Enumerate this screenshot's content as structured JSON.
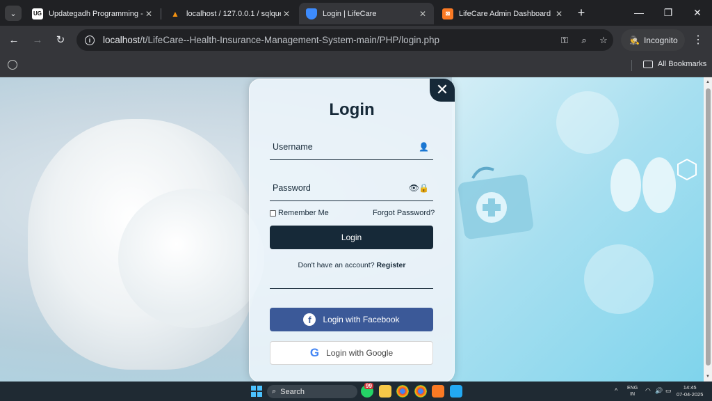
{
  "browser": {
    "tabs": [
      {
        "title": "Updategadh Programming -",
        "active": false,
        "favicon": "ug-logo-icon"
      },
      {
        "title": "localhost / 127.0.0.1 / sqlque",
        "active": false,
        "favicon": "phpmyadmin-icon"
      },
      {
        "title": "Login | LifeCare",
        "active": true,
        "favicon": "shield-icon"
      },
      {
        "title": "LifeCare Admin Dashboard",
        "active": false,
        "favicon": "xampp-icon"
      }
    ],
    "url_host": "localhost",
    "url_path": "/t/LifeCare--Health-Insurance-Management-System-main/PHP/login.php",
    "incognito_label": "Incognito",
    "all_bookmarks_label": "All Bookmarks"
  },
  "login": {
    "title": "Login",
    "username_label": "Username",
    "password_label": "Password",
    "remember_label": "Remember Me",
    "forgot_label": "Forgot Password?",
    "login_button": "Login",
    "register_prompt": "Don't have an account?",
    "register_link": "Register",
    "facebook_button": "Login with Facebook",
    "google_button": "Login with Google"
  },
  "taskbar": {
    "search_label": "Search",
    "badge": "99",
    "lang_line1": "ENG",
    "lang_line2": "IN",
    "time": "14:45",
    "date": "07-04-2025"
  },
  "colors": {
    "primary": "#162938",
    "facebook": "#3b5998",
    "browser_bg": "#202124"
  }
}
